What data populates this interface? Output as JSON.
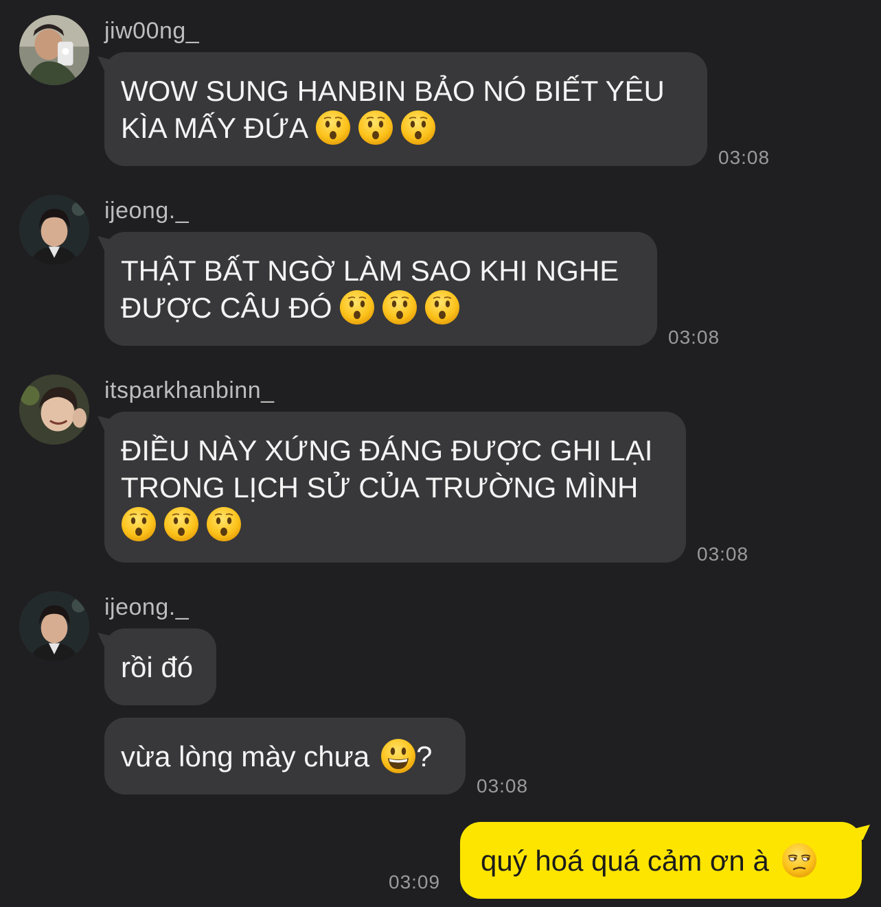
{
  "colors": {
    "background": "#1f1f21",
    "incoming_bubble": "#38383a",
    "outgoing_bubble": "#fee500",
    "username_text": "#bdbdbd",
    "timestamp_text": "#9a9a9a"
  },
  "messages": [
    {
      "sender": "jiw00ng_",
      "avatar_icon": "user-avatar-photo",
      "lines": [
        "WOW SUNG HANBIN BẢO NÓ BIẾT YÊU",
        "KÌA MẤY ĐỨA"
      ],
      "emoji": [
        "hushed-face",
        "hushed-face",
        "hushed-face"
      ],
      "time": "03:08"
    },
    {
      "sender": "ijeong._",
      "avatar_icon": "user-avatar-photo",
      "lines": [
        "THẬT BẤT NGỜ LÀM SAO KHI NGHE",
        "ĐƯỢC CÂU ĐÓ"
      ],
      "emoji": [
        "hushed-face",
        "hushed-face",
        "hushed-face"
      ],
      "time": "03:08"
    },
    {
      "sender": "itsparkhanbinn_",
      "avatar_icon": "user-avatar-photo",
      "lines": [
        "ĐIỀU NÀY XỨNG ĐÁNG ĐƯỢC GHI LẠI",
        "TRONG LỊCH SỬ CỦA TRƯỜNG MÌNH"
      ],
      "emoji": [
        "hushed-face",
        "hushed-face",
        "hushed-face"
      ],
      "time": "03:08"
    },
    {
      "sender": "ijeong._",
      "avatar_icon": "user-avatar-photo",
      "bubble1": "rồi đó",
      "bubble2": "vừa lòng mày chưa",
      "bubble2_emoji": "grinning-face",
      "bubble2_suffix": "?",
      "time": "03:08"
    },
    {
      "sender": "me",
      "text": "quý hoá quá cảm ơn à",
      "emoji": "unamused-face",
      "time": "03:09"
    }
  ]
}
